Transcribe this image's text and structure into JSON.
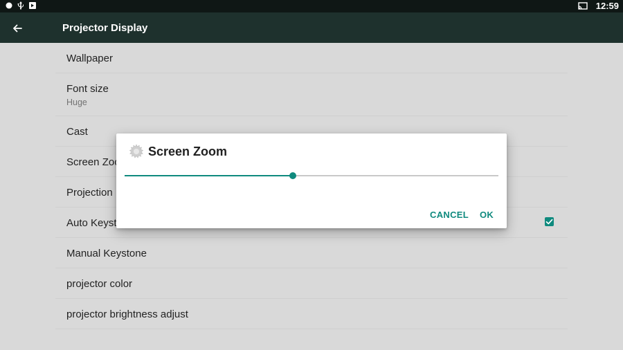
{
  "status_bar": {
    "icons": [
      "circle-icon",
      "usb-icon",
      "cast-notification-icon"
    ],
    "right_icons": [
      "cast-screen-icon"
    ],
    "time": "12:59"
  },
  "app_bar": {
    "back_icon": "arrow-back-icon",
    "title": "Projector Display"
  },
  "settings": [
    {
      "title": "Wallpaper"
    },
    {
      "title": "Font size",
      "subtitle": "Huge"
    },
    {
      "title": "Cast"
    },
    {
      "title": "Screen Zoom"
    },
    {
      "title": "Projection Mode"
    },
    {
      "title": "Auto Keystone",
      "checked": true
    },
    {
      "title": "Manual Keystone"
    },
    {
      "title": "projector color"
    },
    {
      "title": "projector brightness adjust"
    }
  ],
  "dialog": {
    "icon": "gear-icon",
    "title": "Screen Zoom",
    "slider_fraction": 0.45,
    "cancel_label": "CANCEL",
    "ok_label": "OK"
  },
  "colors": {
    "accent": "#0f8a7e",
    "app_bar": "#1e312d",
    "status_bar": "#0f1715",
    "dimmed_background": "#d9d9d9"
  }
}
